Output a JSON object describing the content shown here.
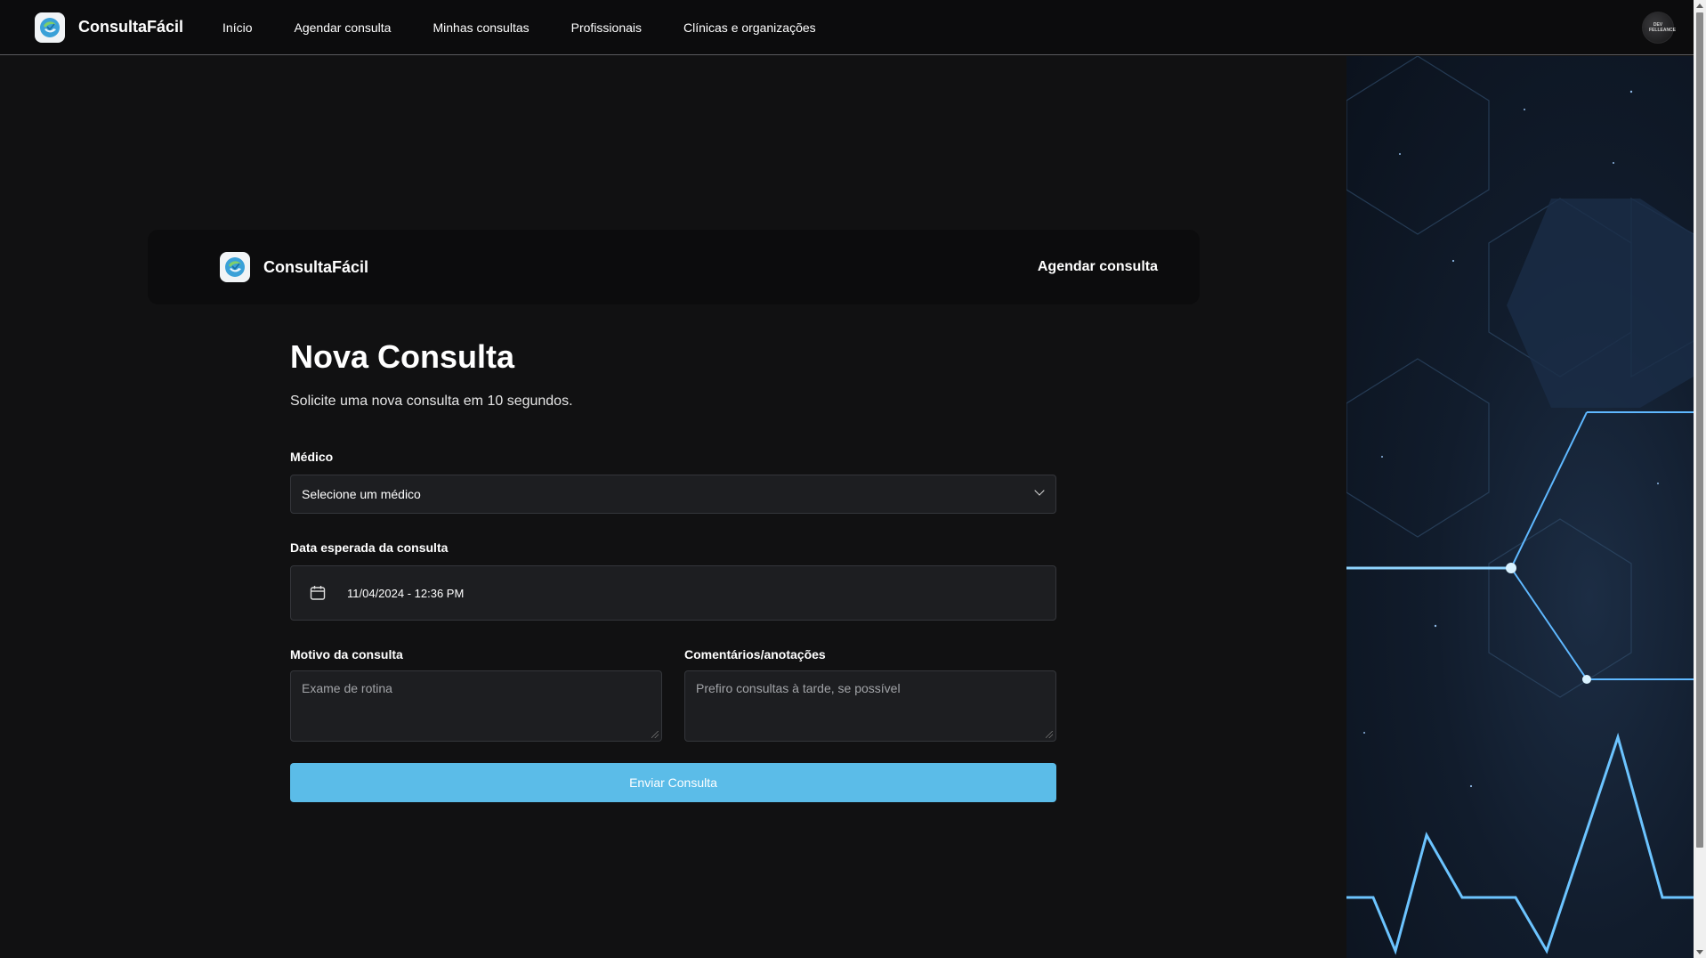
{
  "topnav": {
    "brand": "ConsultaFácil",
    "links": [
      "Início",
      "Agendar consulta",
      "Minhas consultas",
      "Profissionais",
      "Clínicas e organizações"
    ],
    "avatar_text": "DEV FELLEANCE"
  },
  "card_header": {
    "brand": "ConsultaFácil",
    "cta": "Agendar consulta"
  },
  "form": {
    "title": "Nova Consulta",
    "subtitle": "Solicite uma nova consulta em 10 segundos.",
    "doctor_label": "Médico",
    "doctor_value": "Selecione um médico",
    "date_label": "Data esperada da consulta",
    "date_value": "11/04/2024 - 12:36 PM",
    "reason_label": "Motivo da consulta",
    "reason_placeholder": "Exame de rotina",
    "comments_label": "Comentários/anotações",
    "comments_placeholder": "Prefiro consultas à tarde, se possível",
    "submit_label": "Enviar Consulta"
  },
  "colors": {
    "accent": "#5bbce8",
    "background": "#111112",
    "field": "#1d1e21"
  }
}
